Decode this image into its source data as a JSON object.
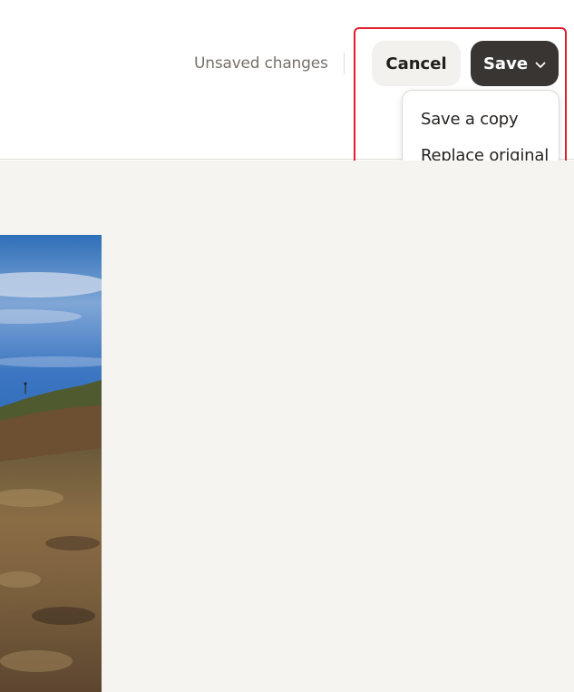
{
  "header": {
    "status_text": "Unsaved changes",
    "cancel_label": "Cancel",
    "save_label": "Save"
  },
  "save_menu": {
    "items": [
      {
        "label": "Save a copy"
      },
      {
        "label": "Replace original"
      }
    ]
  },
  "colors": {
    "save_button_bg": "#393532",
    "cancel_button_bg": "#f3f1ee",
    "highlight_border": "#e01f2d",
    "canvas_bg": "#f5f4f0"
  },
  "icons": {
    "save_dropdown": "chevron-down-icon"
  },
  "image": {
    "subject": "coastal landscape photo"
  }
}
